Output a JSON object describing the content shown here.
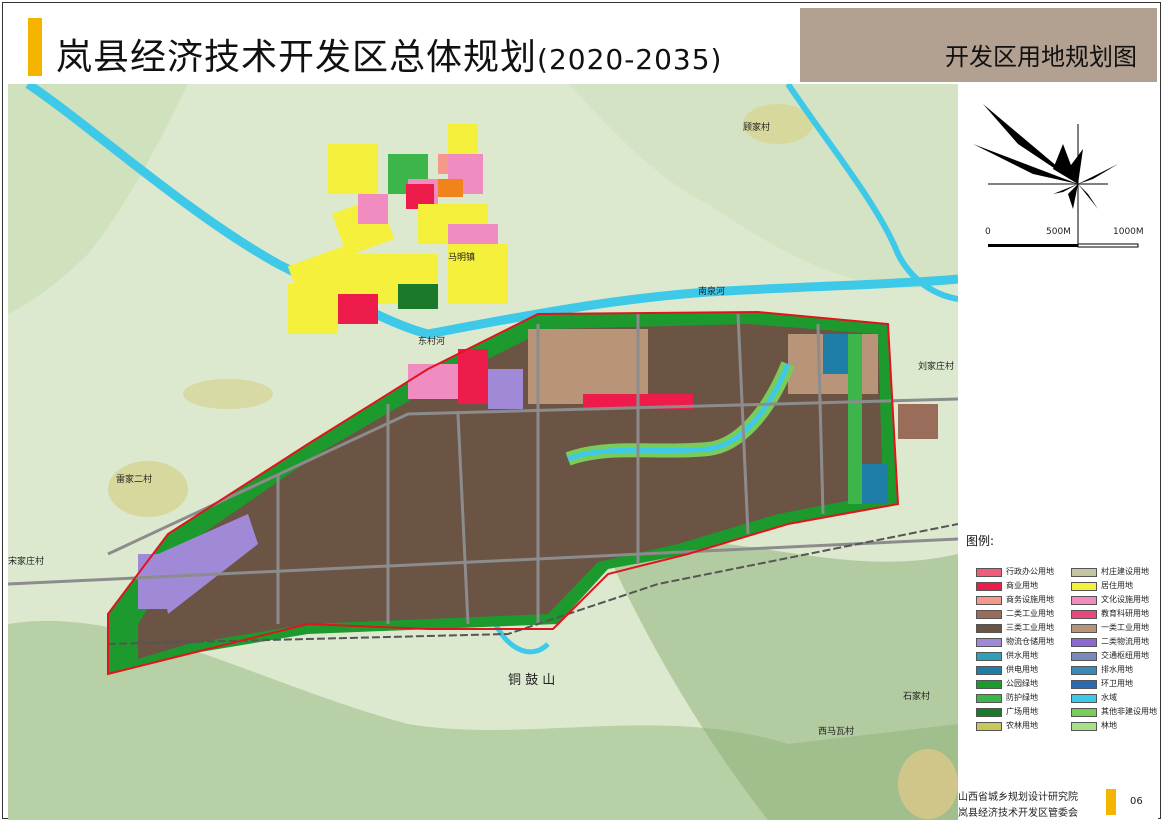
{
  "header": {
    "title": "岚县经济技术开发区总体规划",
    "years": "(2020-2035)",
    "subtitle": "开发区用地规划图"
  },
  "colors": {
    "accent": "#f5b400",
    "subtitle_bg": "#b2a191",
    "industrial": "#6b5444",
    "residential": "#f5f03c",
    "green": "#1d9a2e",
    "river": "#3ec9e8",
    "boundary": "#e0141e",
    "terrain": "#d8e8c8"
  },
  "map": {
    "places": [
      {
        "id": "gu-jia-cun",
        "label": "顾家村"
      },
      {
        "id": "ma-ming-zhen",
        "label": "马明镇"
      },
      {
        "id": "nanjiao-he",
        "label": "南泉河"
      },
      {
        "id": "dongcun-he",
        "label": "东村河"
      },
      {
        "id": "hu-jia-er-cun",
        "label": "雷家二村"
      },
      {
        "id": "song-jia-zhuang",
        "label": "宋家庄村"
      },
      {
        "id": "liu-jia-zhuang",
        "label": "刘家庄村"
      },
      {
        "id": "shan-name",
        "label": "铜 鼓 山"
      },
      {
        "id": "shi-jia-cun",
        "label": "石家村"
      },
      {
        "id": "xi-ma-wa",
        "label": "西马瓦村"
      }
    ]
  },
  "scale": {
    "labels": [
      "0",
      "500M",
      "1000M"
    ]
  },
  "legend": {
    "title": "图例:",
    "items": [
      {
        "label": "行政办公用地",
        "color": "#f25c7a"
      },
      {
        "label": "商业用地",
        "color": "#ee1c4a"
      },
      {
        "label": "商务设施用地",
        "color": "#f59a8a"
      },
      {
        "label": "二类工业用地",
        "color": "#9a6d5a"
      },
      {
        "label": "三类工业用地",
        "color": "#6b5444"
      },
      {
        "label": "物流仓储用地",
        "color": "#a08ad8"
      },
      {
        "label": "供水用地",
        "color": "#2ea0b8"
      },
      {
        "label": "供电用地",
        "color": "#1e7ea8"
      },
      {
        "label": "公园绿地",
        "color": "#1d9a2e"
      },
      {
        "label": "防护绿地",
        "color": "#3db54a"
      },
      {
        "label": "广场用地",
        "color": "#1a7a2a"
      },
      {
        "label": "农林用地",
        "color": "#c8c85a"
      },
      {
        "label": "村庄建设用地",
        "color": "#c4c4a0"
      },
      {
        "label": "居住用地",
        "color": "#f5f03c"
      },
      {
        "label": "文化设施用地",
        "color": "#f08cc0"
      },
      {
        "label": "教育科研用地",
        "color": "#e84880"
      },
      {
        "label": "一类工业用地",
        "color": "#b89478"
      },
      {
        "label": "二类物流用地",
        "color": "#8a6ad0"
      },
      {
        "label": "交通枢纽用地",
        "color": "#7a8ab8"
      },
      {
        "label": "排水用地",
        "color": "#3a8ab8"
      },
      {
        "label": "环卫用地",
        "color": "#2a6ab0"
      },
      {
        "label": "水域",
        "color": "#3ec9e8"
      },
      {
        "label": "其他非建设用地",
        "color": "#7acc5a"
      },
      {
        "label": "林地",
        "color": "#a8e08a"
      }
    ]
  },
  "footer": {
    "org1": "山西省城乡规划设计研究院",
    "org2": "岚县经济技术开发区管委会",
    "page": "06"
  }
}
